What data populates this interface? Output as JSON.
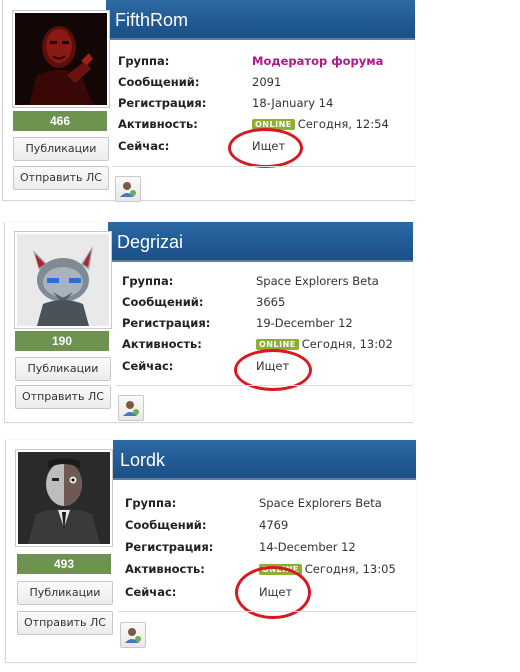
{
  "labels": {
    "group": "Группа:",
    "posts": "Сообщений:",
    "registered": "Регистрация:",
    "activity": "Активность:",
    "now": "Сейчас:",
    "online": "ONLINE",
    "publications": "Публикации",
    "send_pm": "Отправить ЛС"
  },
  "users": [
    {
      "name": "FifthRom",
      "reputation": "466",
      "group": "Модератор форума",
      "posts": "2091",
      "registered": "18-January 14",
      "activity": "Сегодня, 12:54",
      "now": "Ищет",
      "avatar": "dark-red-portrait"
    },
    {
      "name": "Degrizai",
      "reputation": "190",
      "group": "Space Explorers Beta",
      "posts": "3665",
      "registered": "19-December 12",
      "activity": "Сегодня, 13:02",
      "now": "Ищет",
      "avatar": "robot-cat-helmet"
    },
    {
      "name": "Lordk",
      "reputation": "493",
      "group": "Space Explorers Beta",
      "posts": "4769",
      "registered": "14-December 12",
      "activity": "Сегодня, 13:05",
      "now": "Ищет",
      "avatar": "two-face-portrait"
    }
  ],
  "colors": {
    "header": "#235d97",
    "reputation": "#6e9250",
    "online": "#8dad33",
    "moderator": "#b3168a",
    "highlight_ring": "#d71920"
  }
}
